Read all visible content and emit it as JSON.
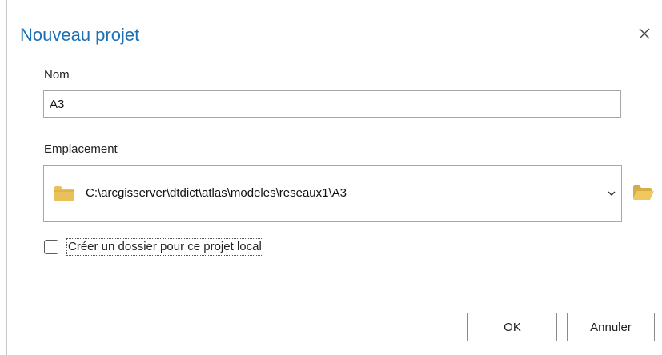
{
  "dialog": {
    "title": "Nouveau projet",
    "close_icon": "close-icon"
  },
  "name_field": {
    "label": "Nom",
    "value": "A3"
  },
  "location_field": {
    "label": "Emplacement",
    "value": "C:\\arcgisserver\\dtdict\\atlas\\modeles\\reseaux1\\A3",
    "folder_icon": "folder-icon",
    "dropdown_icon": "chevron-down-icon",
    "browse_icon": "folder-open-icon"
  },
  "create_folder": {
    "label": "Créer un dossier pour ce projet local",
    "checked": false
  },
  "buttons": {
    "ok": "OK",
    "cancel": "Annuler"
  },
  "colors": {
    "title": "#1f6fb4",
    "folder": "#e8c15a"
  }
}
